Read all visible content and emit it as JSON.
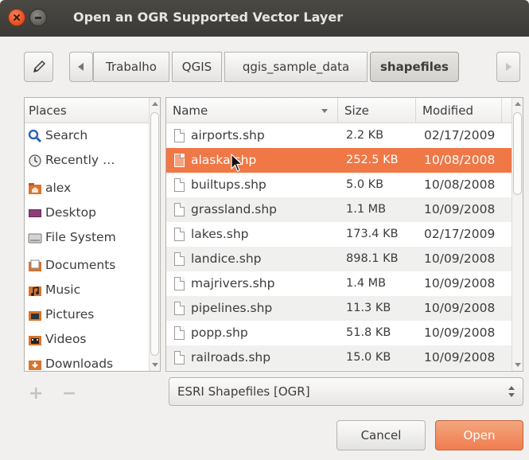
{
  "window": {
    "title": "Open an OGR Supported Vector Layer"
  },
  "pathbar": {
    "crumbs": [
      "Trabalho",
      "QGIS",
      "qgis_sample_data",
      "shapefiles"
    ],
    "current": "shapefiles"
  },
  "places": {
    "header": "Places",
    "items": [
      {
        "label": "Search",
        "icon": "search-icon"
      },
      {
        "label": "Recently …",
        "icon": "recent-icon"
      },
      {
        "label": "alex",
        "icon": "home-folder-icon"
      },
      {
        "label": "Desktop",
        "icon": "desktop-icon"
      },
      {
        "label": "File System",
        "icon": "drive-icon"
      },
      {
        "label": "Documents",
        "icon": "documents-folder-icon"
      },
      {
        "label": "Music",
        "icon": "music-folder-icon"
      },
      {
        "label": "Pictures",
        "icon": "pictures-folder-icon"
      },
      {
        "label": "Videos",
        "icon": "videos-folder-icon"
      },
      {
        "label": "Downloads",
        "icon": "downloads-folder-icon"
      }
    ]
  },
  "files": {
    "columns": {
      "name": "Name",
      "size": "Size",
      "modified": "Modified"
    },
    "rows": [
      {
        "name": "airports.shp",
        "size": "2.2 KB",
        "modified": "02/17/2009"
      },
      {
        "name": "alaska.shp",
        "size": "252.5 KB",
        "modified": "10/08/2008",
        "selected": true
      },
      {
        "name": "builtups.shp",
        "size": "5.0 KB",
        "modified": "10/08/2008"
      },
      {
        "name": "grassland.shp",
        "size": "1.1 MB",
        "modified": "10/09/2008"
      },
      {
        "name": "lakes.shp",
        "size": "173.4 KB",
        "modified": "02/17/2009"
      },
      {
        "name": "landice.shp",
        "size": "898.1 KB",
        "modified": "10/09/2008"
      },
      {
        "name": "majrivers.shp",
        "size": "1.4 MB",
        "modified": "10/09/2008"
      },
      {
        "name": "pipelines.shp",
        "size": "11.3 KB",
        "modified": "10/09/2008"
      },
      {
        "name": "popp.shp",
        "size": "51.8 KB",
        "modified": "10/09/2008"
      },
      {
        "name": "railroads.shp",
        "size": "15.0 KB",
        "modified": "10/09/2008"
      }
    ]
  },
  "filter": {
    "selected": "ESRI Shapefiles [OGR]"
  },
  "buttons": {
    "cancel": "Cancel",
    "open": "Open"
  },
  "colors": {
    "accent": "#f07746",
    "titlebar": "#3c3b37"
  }
}
